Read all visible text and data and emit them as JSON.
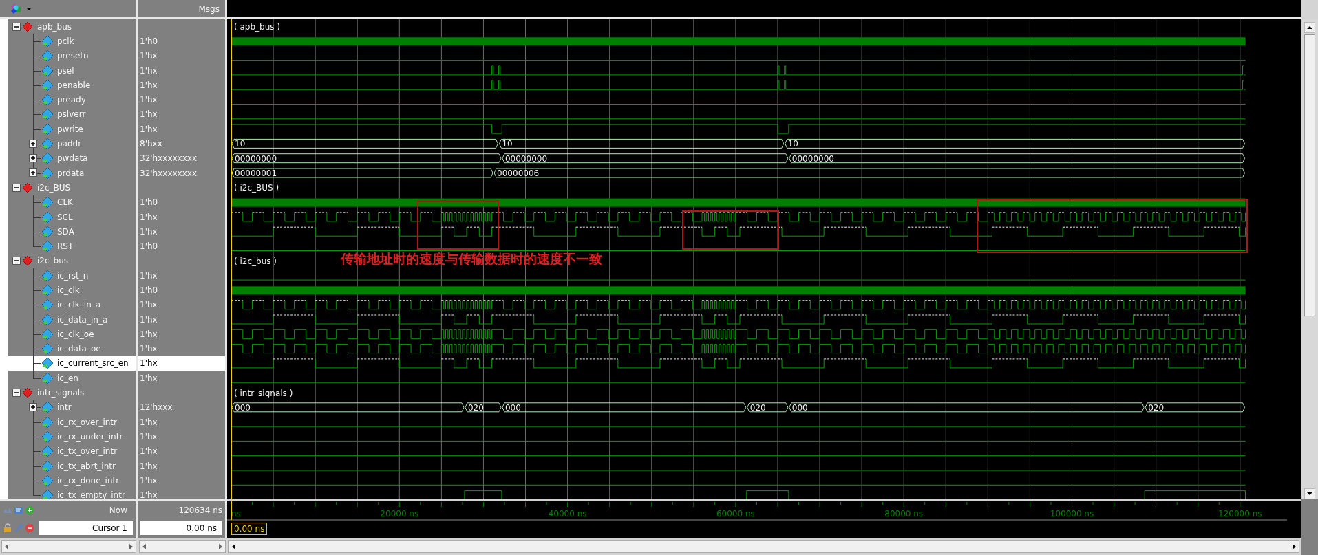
{
  "header": {
    "values_title": "Msgs"
  },
  "signals": [
    {
      "kind": "group",
      "name": "apb_bus",
      "expanded": true,
      "selected": false,
      "wave_label": "( apb_bus )",
      "children": [
        {
          "kind": "clock",
          "name": "pclk",
          "value": "1'h0",
          "selected": false
        },
        {
          "kind": "low",
          "name": "presetn",
          "value": "1'hx",
          "selected": false
        },
        {
          "kind": "pulse",
          "name": "psel",
          "value": "1'hx",
          "selected": false
        },
        {
          "kind": "pulse",
          "name": "penable",
          "value": "1'hx",
          "selected": false
        },
        {
          "kind": "low",
          "name": "pready",
          "value": "1'hx",
          "selected": false
        },
        {
          "kind": "low",
          "name": "pslverr",
          "value": "1'hx",
          "selected": false
        },
        {
          "kind": "dip",
          "name": "pwrite",
          "value": "1'hx",
          "selected": false
        },
        {
          "kind": "bus",
          "name": "paddr",
          "value": "8'hxx",
          "expanded": false,
          "selected": false,
          "segments": [
            "10",
            "10",
            "10"
          ]
        },
        {
          "kind": "bus",
          "name": "pwdata",
          "value": "32'hxxxxxxxx",
          "expanded": false,
          "selected": false,
          "segments": [
            "00000000",
            "00000000",
            "00000000"
          ]
        },
        {
          "kind": "bus",
          "name": "prdata",
          "value": "32'hxxxxxxxx",
          "expanded": false,
          "selected": false,
          "segments": [
            "00000001",
            "00000006"
          ]
        }
      ]
    },
    {
      "kind": "group",
      "name": "i2c_BUS",
      "expanded": true,
      "selected": false,
      "wave_label": "( i2c_BUS )",
      "children": [
        {
          "kind": "clock",
          "name": "CLK",
          "value": "1'h0",
          "selected": false
        },
        {
          "kind": "scl",
          "name": "SCL",
          "value": "1'hx",
          "selected": false
        },
        {
          "kind": "sda",
          "name": "SDA",
          "value": "1'hx",
          "selected": false
        },
        {
          "kind": "low",
          "name": "RST",
          "value": "1'h0",
          "selected": false
        }
      ]
    },
    {
      "kind": "group",
      "name": "i2c_bus",
      "expanded": true,
      "selected": false,
      "wave_label": "( i2c_bus )",
      "children": [
        {
          "kind": "low",
          "name": "ic_rst_n",
          "value": "1'hx",
          "selected": false
        },
        {
          "kind": "clock",
          "name": "ic_clk",
          "value": "1'h0",
          "selected": false
        },
        {
          "kind": "scl",
          "name": "ic_clk_in_a",
          "value": "1'hx",
          "selected": false
        },
        {
          "kind": "sda",
          "name": "ic_data_in_a",
          "value": "1'hx",
          "selected": false
        },
        {
          "kind": "oe",
          "name": "ic_clk_oe",
          "value": "1'hx",
          "selected": false
        },
        {
          "kind": "oe",
          "name": "ic_data_oe",
          "value": "1'hx",
          "selected": false
        },
        {
          "kind": "sda",
          "name": "ic_current_src_en",
          "value": "1'hx",
          "selected": true
        },
        {
          "kind": "low",
          "name": "ic_en",
          "value": "1'hx",
          "selected": false
        }
      ]
    },
    {
      "kind": "group",
      "name": "intr_signals",
      "expanded": true,
      "selected": false,
      "wave_label": "( intr_signals )",
      "children": [
        {
          "kind": "bus",
          "name": "intr",
          "value": "12'hxxx",
          "expanded": false,
          "selected": false,
          "segments": [
            "000",
            "020",
            "000",
            "020",
            "000",
            "020"
          ]
        },
        {
          "kind": "low",
          "name": "ic_rx_over_intr",
          "value": "1'hx",
          "selected": false
        },
        {
          "kind": "low",
          "name": "ic_rx_under_intr",
          "value": "1'hx",
          "selected": false
        },
        {
          "kind": "low",
          "name": "ic_tx_over_intr",
          "value": "1'hx",
          "selected": false
        },
        {
          "kind": "low",
          "name": "ic_tx_abrt_intr",
          "value": "1'hx",
          "selected": false
        },
        {
          "kind": "low",
          "name": "ic_rx_done_intr",
          "value": "1'hx",
          "selected": false
        },
        {
          "kind": "pulse",
          "name": "ic_tx_empty_intr",
          "value": "1'hx",
          "selected": false
        }
      ]
    }
  ],
  "annotation": "传输地址时的速度与传输数据时的速度不一致",
  "now": {
    "label": "Now",
    "value": "120634 ns"
  },
  "cursor": {
    "label": "Cursor 1",
    "value": "0.00 ns",
    "marker": "0.00 ns"
  },
  "time_axis": [
    "ns",
    "20000 ns",
    "40000 ns",
    "60000 ns",
    "80000 ns",
    "100000 ns",
    "120000 ns"
  ]
}
